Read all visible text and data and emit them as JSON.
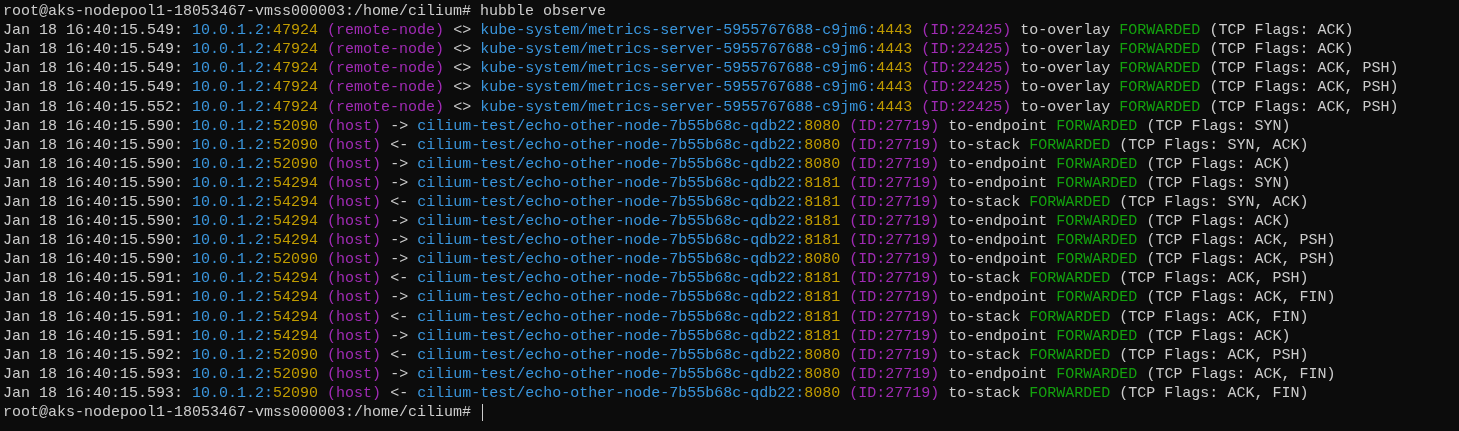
{
  "lines": [
    {
      "kind": "prompt",
      "prompt": "root@aks-nodepool1-18053467-vmss000003:/home/cilium#",
      "command": "hubble observe"
    },
    {
      "kind": "flow",
      "time": "Jan 18 16:40:15.549:",
      "src": "10.0.1.2:",
      "src_port": "47924",
      "src_identity": "(remote-node)",
      "direction": "<>",
      "dst": "kube-system/metrics-server-5955767688-c9jm6:",
      "dst_port": "4443",
      "dst_identity": "(ID:22425)",
      "observation": "to-overlay",
      "verdict": "FORWARDED",
      "flags": "(TCP Flags: ACK)"
    },
    {
      "kind": "flow",
      "time": "Jan 18 16:40:15.549:",
      "src": "10.0.1.2:",
      "src_port": "47924",
      "src_identity": "(remote-node)",
      "direction": "<>",
      "dst": "kube-system/metrics-server-5955767688-c9jm6:",
      "dst_port": "4443",
      "dst_identity": "(ID:22425)",
      "observation": "to-overlay",
      "verdict": "FORWARDED",
      "flags": "(TCP Flags: ACK)"
    },
    {
      "kind": "flow",
      "time": "Jan 18 16:40:15.549:",
      "src": "10.0.1.2:",
      "src_port": "47924",
      "src_identity": "(remote-node)",
      "direction": "<>",
      "dst": "kube-system/metrics-server-5955767688-c9jm6:",
      "dst_port": "4443",
      "dst_identity": "(ID:22425)",
      "observation": "to-overlay",
      "verdict": "FORWARDED",
      "flags": "(TCP Flags: ACK, PSH)"
    },
    {
      "kind": "flow",
      "time": "Jan 18 16:40:15.549:",
      "src": "10.0.1.2:",
      "src_port": "47924",
      "src_identity": "(remote-node)",
      "direction": "<>",
      "dst": "kube-system/metrics-server-5955767688-c9jm6:",
      "dst_port": "4443",
      "dst_identity": "(ID:22425)",
      "observation": "to-overlay",
      "verdict": "FORWARDED",
      "flags": "(TCP Flags: ACK, PSH)"
    },
    {
      "kind": "flow",
      "time": "Jan 18 16:40:15.552:",
      "src": "10.0.1.2:",
      "src_port": "47924",
      "src_identity": "(remote-node)",
      "direction": "<>",
      "dst": "kube-system/metrics-server-5955767688-c9jm6:",
      "dst_port": "4443",
      "dst_identity": "(ID:22425)",
      "observation": "to-overlay",
      "verdict": "FORWARDED",
      "flags": "(TCP Flags: ACK, PSH)"
    },
    {
      "kind": "flow",
      "time": "Jan 18 16:40:15.590:",
      "src": "10.0.1.2:",
      "src_port": "52090",
      "src_identity": "(host)",
      "direction": "->",
      "dst": "cilium-test/echo-other-node-7b55b68c-qdb22:",
      "dst_port": "8080",
      "dst_identity": "(ID:27719)",
      "observation": "to-endpoint",
      "verdict": "FORWARDED",
      "flags": "(TCP Flags: SYN)"
    },
    {
      "kind": "flow",
      "time": "Jan 18 16:40:15.590:",
      "src": "10.0.1.2:",
      "src_port": "52090",
      "src_identity": "(host)",
      "direction": "<-",
      "dst": "cilium-test/echo-other-node-7b55b68c-qdb22:",
      "dst_port": "8080",
      "dst_identity": "(ID:27719)",
      "observation": "to-stack",
      "verdict": "FORWARDED",
      "flags": "(TCP Flags: SYN, ACK)"
    },
    {
      "kind": "flow",
      "time": "Jan 18 16:40:15.590:",
      "src": "10.0.1.2:",
      "src_port": "52090",
      "src_identity": "(host)",
      "direction": "->",
      "dst": "cilium-test/echo-other-node-7b55b68c-qdb22:",
      "dst_port": "8080",
      "dst_identity": "(ID:27719)",
      "observation": "to-endpoint",
      "verdict": "FORWARDED",
      "flags": "(TCP Flags: ACK)"
    },
    {
      "kind": "flow",
      "time": "Jan 18 16:40:15.590:",
      "src": "10.0.1.2:",
      "src_port": "54294",
      "src_identity": "(host)",
      "direction": "->",
      "dst": "cilium-test/echo-other-node-7b55b68c-qdb22:",
      "dst_port": "8181",
      "dst_identity": "(ID:27719)",
      "observation": "to-endpoint",
      "verdict": "FORWARDED",
      "flags": "(TCP Flags: SYN)"
    },
    {
      "kind": "flow",
      "time": "Jan 18 16:40:15.590:",
      "src": "10.0.1.2:",
      "src_port": "54294",
      "src_identity": "(host)",
      "direction": "<-",
      "dst": "cilium-test/echo-other-node-7b55b68c-qdb22:",
      "dst_port": "8181",
      "dst_identity": "(ID:27719)",
      "observation": "to-stack",
      "verdict": "FORWARDED",
      "flags": "(TCP Flags: SYN, ACK)"
    },
    {
      "kind": "flow",
      "time": "Jan 18 16:40:15.590:",
      "src": "10.0.1.2:",
      "src_port": "54294",
      "src_identity": "(host)",
      "direction": "->",
      "dst": "cilium-test/echo-other-node-7b55b68c-qdb22:",
      "dst_port": "8181",
      "dst_identity": "(ID:27719)",
      "observation": "to-endpoint",
      "verdict": "FORWARDED",
      "flags": "(TCP Flags: ACK)"
    },
    {
      "kind": "flow",
      "time": "Jan 18 16:40:15.590:",
      "src": "10.0.1.2:",
      "src_port": "54294",
      "src_identity": "(host)",
      "direction": "->",
      "dst": "cilium-test/echo-other-node-7b55b68c-qdb22:",
      "dst_port": "8181",
      "dst_identity": "(ID:27719)",
      "observation": "to-endpoint",
      "verdict": "FORWARDED",
      "flags": "(TCP Flags: ACK, PSH)"
    },
    {
      "kind": "flow",
      "time": "Jan 18 16:40:15.590:",
      "src": "10.0.1.2:",
      "src_port": "52090",
      "src_identity": "(host)",
      "direction": "->",
      "dst": "cilium-test/echo-other-node-7b55b68c-qdb22:",
      "dst_port": "8080",
      "dst_identity": "(ID:27719)",
      "observation": "to-endpoint",
      "verdict": "FORWARDED",
      "flags": "(TCP Flags: ACK, PSH)"
    },
    {
      "kind": "flow",
      "time": "Jan 18 16:40:15.591:",
      "src": "10.0.1.2:",
      "src_port": "54294",
      "src_identity": "(host)",
      "direction": "<-",
      "dst": "cilium-test/echo-other-node-7b55b68c-qdb22:",
      "dst_port": "8181",
      "dst_identity": "(ID:27719)",
      "observation": "to-stack",
      "verdict": "FORWARDED",
      "flags": "(TCP Flags: ACK, PSH)"
    },
    {
      "kind": "flow",
      "time": "Jan 18 16:40:15.591:",
      "src": "10.0.1.2:",
      "src_port": "54294",
      "src_identity": "(host)",
      "direction": "->",
      "dst": "cilium-test/echo-other-node-7b55b68c-qdb22:",
      "dst_port": "8181",
      "dst_identity": "(ID:27719)",
      "observation": "to-endpoint",
      "verdict": "FORWARDED",
      "flags": "(TCP Flags: ACK, FIN)"
    },
    {
      "kind": "flow",
      "time": "Jan 18 16:40:15.591:",
      "src": "10.0.1.2:",
      "src_port": "54294",
      "src_identity": "(host)",
      "direction": "<-",
      "dst": "cilium-test/echo-other-node-7b55b68c-qdb22:",
      "dst_port": "8181",
      "dst_identity": "(ID:27719)",
      "observation": "to-stack",
      "verdict": "FORWARDED",
      "flags": "(TCP Flags: ACK, FIN)"
    },
    {
      "kind": "flow",
      "time": "Jan 18 16:40:15.591:",
      "src": "10.0.1.2:",
      "src_port": "54294",
      "src_identity": "(host)",
      "direction": "->",
      "dst": "cilium-test/echo-other-node-7b55b68c-qdb22:",
      "dst_port": "8181",
      "dst_identity": "(ID:27719)",
      "observation": "to-endpoint",
      "verdict": "FORWARDED",
      "flags": "(TCP Flags: ACK)"
    },
    {
      "kind": "flow",
      "time": "Jan 18 16:40:15.592:",
      "src": "10.0.1.2:",
      "src_port": "52090",
      "src_identity": "(host)",
      "direction": "<-",
      "dst": "cilium-test/echo-other-node-7b55b68c-qdb22:",
      "dst_port": "8080",
      "dst_identity": "(ID:27719)",
      "observation": "to-stack",
      "verdict": "FORWARDED",
      "flags": "(TCP Flags: ACK, PSH)"
    },
    {
      "kind": "flow",
      "time": "Jan 18 16:40:15.593:",
      "src": "10.0.1.2:",
      "src_port": "52090",
      "src_identity": "(host)",
      "direction": "->",
      "dst": "cilium-test/echo-other-node-7b55b68c-qdb22:",
      "dst_port": "8080",
      "dst_identity": "(ID:27719)",
      "observation": "to-endpoint",
      "verdict": "FORWARDED",
      "flags": "(TCP Flags: ACK, FIN)"
    },
    {
      "kind": "flow",
      "time": "Jan 18 16:40:15.593:",
      "src": "10.0.1.2:",
      "src_port": "52090",
      "src_identity": "(host)",
      "direction": "<-",
      "dst": "cilium-test/echo-other-node-7b55b68c-qdb22:",
      "dst_port": "8080",
      "dst_identity": "(ID:27719)",
      "observation": "to-stack",
      "verdict": "FORWARDED",
      "flags": "(TCP Flags: ACK, FIN)"
    },
    {
      "kind": "prompt",
      "prompt": "root@aks-nodepool1-18053467-vmss000003:/home/cilium#",
      "cursor": true
    }
  ]
}
